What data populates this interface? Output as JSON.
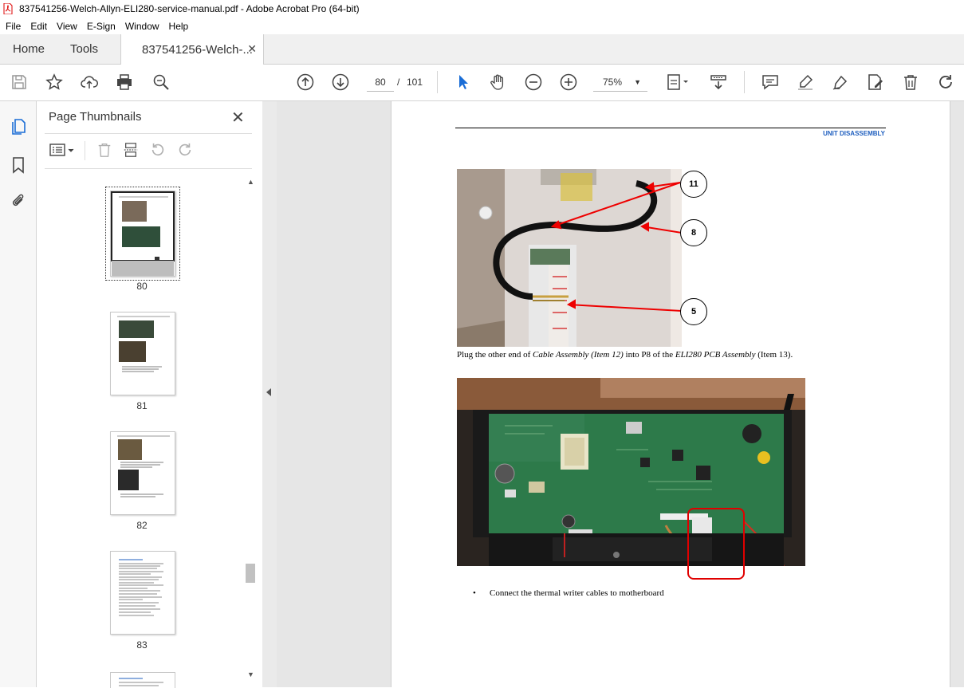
{
  "window": {
    "title": "837541256-Welch-Allyn-ELI280-service-manual.pdf - Adobe Acrobat Pro (64-bit)"
  },
  "menu": [
    "File",
    "Edit",
    "View",
    "E-Sign",
    "Window",
    "Help"
  ],
  "tabs": {
    "home": "Home",
    "tools": "Tools",
    "document": "837541256-Welch-..."
  },
  "toolbar": {
    "current_page": "80",
    "page_separator": "/",
    "total_pages": "101",
    "zoom": "75%"
  },
  "thumbnails_panel": {
    "title": "Page Thumbnails",
    "pages": [
      {
        "label": "80",
        "selected": true
      },
      {
        "label": "81",
        "selected": false
      },
      {
        "label": "82",
        "selected": false
      },
      {
        "label": "83",
        "selected": false
      }
    ]
  },
  "document_page": {
    "header": "UNIT DISASSEMBLY",
    "callouts": [
      "11",
      "8",
      "5"
    ],
    "caption_parts": {
      "a": "Plug the other end of ",
      "b": "Cable Assembly (Item 12)",
      "c": " into P8 of the ",
      "d": "ELI280 PCB Assembly",
      "e": " (Item 13)."
    },
    "bullet_marker": "•",
    "bullet": "Connect the thermal writer cables to motherboard"
  }
}
